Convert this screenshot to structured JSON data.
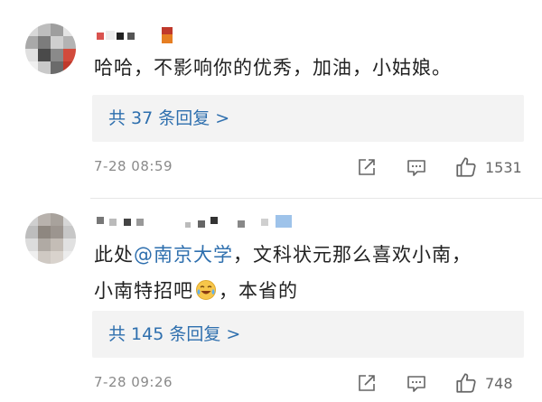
{
  "comments": [
    {
      "text": "哈哈，不影响你的优秀，加油，小姑娘。",
      "reply_link": "共 37 条回复 >",
      "timestamp": "7-28 08:59",
      "like_count": "1531"
    },
    {
      "line1_prefix": "此处",
      "mention": "@南京大学",
      "line1_suffix": "，文科状元那么喜欢小南，",
      "line2_prefix": "小南特招吧",
      "emoji_name": "laughing-crying-emoji",
      "line2_suffix": "，本省的",
      "reply_link": "共 145 条回复 >",
      "timestamp": "7-28 09:26",
      "like_count": "748"
    }
  ],
  "icons": {
    "share": "share-icon",
    "reply": "comment-icon",
    "like": "thumbs-up-icon"
  },
  "colors": {
    "link": "#2e6fae",
    "reply_bg": "#f3f3f3",
    "meta": "#8a8a8a"
  }
}
